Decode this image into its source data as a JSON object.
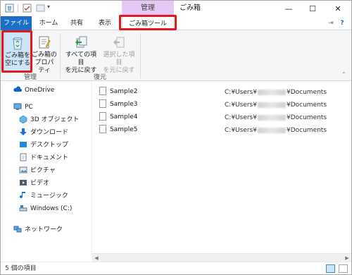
{
  "titlebar": {
    "context_header": "管理",
    "title": "ごみ箱",
    "minimize": "—",
    "maximize": "☐",
    "close": "✕"
  },
  "tabs": {
    "file": "ファイル",
    "home": "ホーム",
    "share": "共有",
    "view": "表示",
    "recycle_tools": "ごみ箱ツール",
    "pin": "⇥",
    "help": "?"
  },
  "ribbon": {
    "empty_line1": "ごみ箱を",
    "empty_line2": "空にする",
    "props_line1": "ごみ箱の",
    "props_line2": "プロパティ",
    "restore_all_line1": "すべての項目",
    "restore_all_line2": "を元に戻す",
    "restore_sel_line1": "選択した項目",
    "restore_sel_line2": "を元に戻す",
    "group_manage": "管理",
    "group_restore": "復元",
    "collapse": "⌃"
  },
  "nav": {
    "items": [
      {
        "label": "OneDrive",
        "icon": "onedrive-icon"
      },
      {
        "label": "PC",
        "icon": "pc-icon"
      },
      {
        "label": "3D オブジェクト",
        "icon": "3d-objects-icon"
      },
      {
        "label": "ダウンロード",
        "icon": "download-icon"
      },
      {
        "label": "デスクトップ",
        "icon": "desktop-icon"
      },
      {
        "label": "ドキュメント",
        "icon": "documents-icon"
      },
      {
        "label": "ピクチャ",
        "icon": "pictures-icon"
      },
      {
        "label": "ビデオ",
        "icon": "videos-icon"
      },
      {
        "label": "ミュージック",
        "icon": "music-icon"
      },
      {
        "label": "Windows (C:)",
        "icon": "drive-icon"
      },
      {
        "label": "ネットワーク",
        "icon": "network-icon"
      }
    ]
  },
  "files": [
    {
      "name": "Sample2",
      "path_prefix": "C:¥Users¥",
      "path_suffix": "¥Documents"
    },
    {
      "name": "Sample3",
      "path_prefix": "C:¥Users¥",
      "path_suffix": "¥Documents"
    },
    {
      "name": "Sample4",
      "path_prefix": "C:¥Users¥",
      "path_suffix": "¥Documents"
    },
    {
      "name": "Sample5",
      "path_prefix": "C:¥Users¥",
      "path_suffix": "¥Documents"
    }
  ],
  "status": {
    "count_text": "5 個の項目"
  },
  "colors": {
    "file_tab": "#1a6fc8",
    "context_header": "#e6c8f4",
    "highlight_box": "#e2181f",
    "active_button": "#cce4f7"
  }
}
